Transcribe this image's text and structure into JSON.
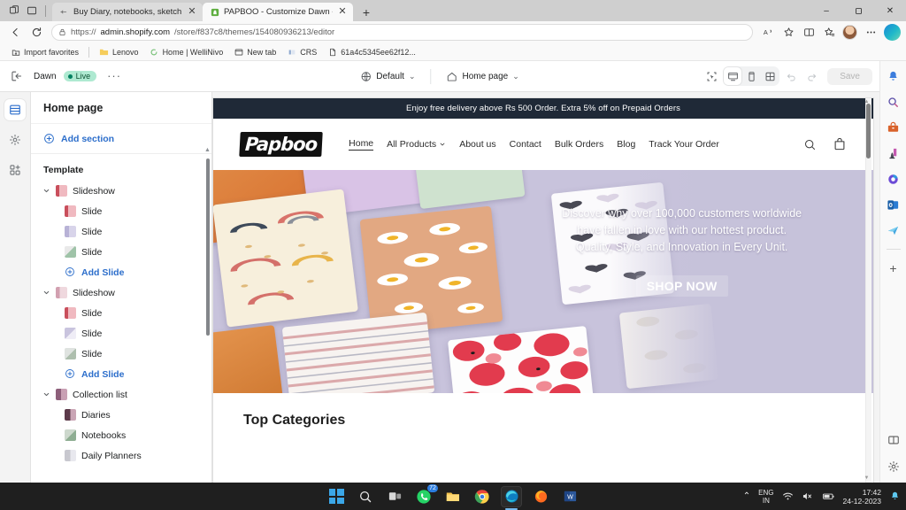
{
  "browser": {
    "tabs": [
      {
        "title": "Buy Diary, notebooks, sketchbo",
        "favicon": "generic-page-icon",
        "active": false
      },
      {
        "title": "PAPBOO - Customize Dawn - Sh",
        "favicon": "shopify-icon",
        "active": true
      }
    ],
    "new_tab_label": "+",
    "tab_strip_icons": [
      "copilot-tabs-icon",
      "tab-actions-icon"
    ],
    "window_controls": {
      "minimize": "–",
      "maximize": "❐",
      "close": "✕"
    },
    "nav": {
      "back_icon": "back-arrow-icon",
      "refresh_icon": "refresh-icon",
      "lock_icon": "lock-icon",
      "url_prefix": "https://",
      "url_domain": "admin.shopify.com",
      "url_path": "/store/f837c8/themes/154080936213/editor",
      "right_icons": [
        "read-aloud-icon",
        "favorite-star-icon",
        "split-screen-icon",
        "collections-icon",
        "profile-avatar",
        "settings-more-icon",
        "copilot-icon"
      ]
    },
    "bookmarks": [
      {
        "label": "Import favorites",
        "icon": "import-favorites-icon"
      },
      {
        "label": "Lenovo",
        "icon": "folder-icon"
      },
      {
        "label": "Home | WelliNivo",
        "icon": "site-icon"
      },
      {
        "label": "New tab",
        "icon": "newtab-icon"
      },
      {
        "label": "CRS",
        "icon": "crs-icon"
      },
      {
        "label": "61a4c5345ee62f12...",
        "icon": "document-icon"
      }
    ]
  },
  "edge_sidebar": {
    "items": [
      {
        "name": "notifications-bell-icon",
        "label": "Notifications"
      },
      {
        "name": "search-icon",
        "label": "Search"
      },
      {
        "name": "shopping-icon",
        "label": "Shopping"
      },
      {
        "name": "games-icon",
        "label": "Games"
      },
      {
        "name": "copilot-icon",
        "label": "Copilot"
      },
      {
        "name": "outlook-icon",
        "label": "Outlook"
      },
      {
        "name": "send-icon",
        "label": "Drop"
      }
    ],
    "add_label": "+",
    "bottom_items": [
      {
        "name": "split-screen-icon",
        "label": "Split screen"
      },
      {
        "name": "settings-gear-icon",
        "label": "Settings"
      }
    ]
  },
  "editor": {
    "exit_icon": "exit-editor-icon",
    "theme_name": "Dawn",
    "status_badge": "Live",
    "more_actions": "···",
    "locale_selector": {
      "icon": "globe-icon",
      "label": "Default",
      "caret": "⌄"
    },
    "page_selector": {
      "icon": "home-icon",
      "label": "Home page",
      "caret": "⌄"
    },
    "toolbar": {
      "inspector_icon": "inspector-icon",
      "desktop_icon": "desktop-view-icon",
      "mobile_icon": "mobile-view-icon",
      "fullscreen_icon": "fullscreen-view-icon",
      "undo_icon": "undo-icon",
      "redo_icon": "redo-icon",
      "save_label": "Save"
    },
    "rail": [
      {
        "name": "sections-icon",
        "label": "Sections",
        "selected": true
      },
      {
        "name": "theme-settings-icon",
        "label": "Theme settings",
        "selected": false
      },
      {
        "name": "apps-icon",
        "label": "Apps",
        "selected": false
      }
    ],
    "panel": {
      "title": "Home page",
      "add_section_label": "Add section",
      "template_label": "Template",
      "tree": [
        {
          "label": "Slideshow",
          "type": "section",
          "thumb": "th-a",
          "indent": 0,
          "caret": true
        },
        {
          "label": "Slide",
          "type": "block",
          "thumb": "th-a",
          "indent": 1
        },
        {
          "label": "Slide",
          "type": "block",
          "thumb": "th-b",
          "indent": 1
        },
        {
          "label": "Slide",
          "type": "block",
          "thumb": "th-c",
          "indent": 1
        },
        {
          "label": "Add Slide",
          "type": "add",
          "indent": 1
        },
        {
          "label": "Slideshow",
          "type": "section",
          "thumb": "th-d",
          "indent": 0,
          "caret": true
        },
        {
          "label": "Slide",
          "type": "block",
          "thumb": "th-a",
          "indent": 1
        },
        {
          "label": "Slide",
          "type": "block",
          "thumb": "th-e",
          "indent": 1
        },
        {
          "label": "Slide",
          "type": "block",
          "thumb": "th-f",
          "indent": 1
        },
        {
          "label": "Add Slide",
          "type": "add",
          "indent": 1
        },
        {
          "label": "Collection list",
          "type": "section",
          "thumb": "th-g",
          "indent": 0,
          "caret": true
        },
        {
          "label": "Diaries",
          "type": "block",
          "thumb": "th-h",
          "indent": 1
        },
        {
          "label": "Notebooks",
          "type": "block",
          "thumb": "th-i",
          "indent": 1
        },
        {
          "label": "Daily Planners",
          "type": "block",
          "thumb": "th-j",
          "indent": 1
        }
      ]
    }
  },
  "store_preview": {
    "announcement": "Enjoy free delivery above Rs 500 Order. Extra 5% off on Prepaid Orders",
    "logo_text": "Papboo",
    "nav": [
      {
        "label": "Home",
        "active": true,
        "caret": false
      },
      {
        "label": "All Products",
        "active": false,
        "caret": true
      },
      {
        "label": "About us",
        "active": false,
        "caret": false
      },
      {
        "label": "Contact",
        "active": false,
        "caret": false
      },
      {
        "label": "Bulk Orders",
        "active": false,
        "caret": false
      },
      {
        "label": "Blog",
        "active": false,
        "caret": false
      },
      {
        "label": "Track Your Order",
        "active": false,
        "caret": false
      }
    ],
    "header_actions": [
      {
        "name": "search-icon",
        "label": "Search"
      },
      {
        "name": "cart-icon",
        "label": "Cart"
      }
    ],
    "hero": {
      "line1": "Discover why over 100,000 customers worldwide",
      "line2": "have fallen in love with our hottest product.",
      "line3": "Quality, Style, and Innovation in Every Unit.",
      "cta_label": "SHOP NOW"
    },
    "section_heading": "Top Categories"
  },
  "taskbar": {
    "items": [
      {
        "name": "start-button",
        "label": "Start"
      },
      {
        "name": "search-icon",
        "label": "Search"
      },
      {
        "name": "task-view-icon",
        "label": "Task view"
      },
      {
        "name": "whatsapp-icon",
        "label": "WhatsApp",
        "badge": "72"
      },
      {
        "name": "file-explorer-icon",
        "label": "File Explorer"
      },
      {
        "name": "chrome-icon",
        "label": "Google Chrome"
      },
      {
        "name": "edge-icon",
        "label": "Microsoft Edge",
        "active": true
      },
      {
        "name": "firefox-icon",
        "label": "Firefox"
      },
      {
        "name": "word-icon",
        "label": "Microsoft Word"
      }
    ],
    "tray": {
      "chevron": "⌃",
      "language_line1": "ENG",
      "language_line2": "IN",
      "wifi_icon": "wifi-icon",
      "volume_icon": "volume-muted-icon",
      "battery_icon": "battery-icon",
      "time": "17:42",
      "date": "24-12-2023",
      "notification_icon": "notification-bell-icon"
    }
  },
  "colors": {
    "shopify_link": "#2c6ecb",
    "live_badge_bg": "#aee9d1",
    "live_badge_text": "#0c5132",
    "announcement_bg": "#1f2937",
    "hero_bg": "#c6c2da",
    "taskbar_bg": "#1f1f1f"
  }
}
